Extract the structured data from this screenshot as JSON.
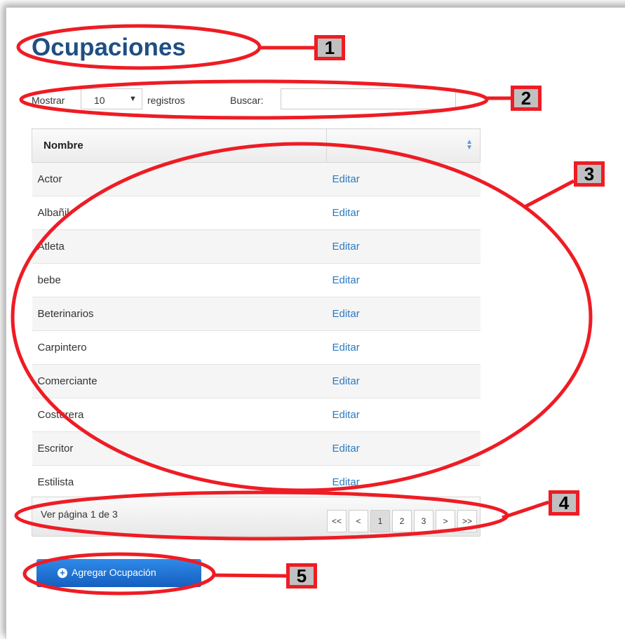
{
  "page": {
    "title": "Ocupaciones"
  },
  "controls": {
    "show_label": "Mostrar",
    "page_size": "10",
    "records_label": "registros",
    "search_label": "Buscar:",
    "search_value": ""
  },
  "table": {
    "columns": [
      "Nombre",
      ""
    ],
    "rows": [
      {
        "name": "Actor",
        "action": "Editar"
      },
      {
        "name": "Albañil",
        "action": "Editar"
      },
      {
        "name": "Atleta",
        "action": "Editar"
      },
      {
        "name": "bebe",
        "action": "Editar"
      },
      {
        "name": "Beterinarios",
        "action": "Editar"
      },
      {
        "name": "Carpintero",
        "action": "Editar"
      },
      {
        "name": "Comerciante",
        "action": "Editar"
      },
      {
        "name": "Costurera",
        "action": "Editar"
      },
      {
        "name": "Escritor",
        "action": "Editar"
      },
      {
        "name": "Estilista",
        "action": "Editar"
      }
    ]
  },
  "pagination": {
    "info": "Ver página 1 de 3",
    "buttons": [
      "<<",
      "<",
      "1",
      "2",
      "3",
      ">",
      ">>"
    ],
    "current": "1"
  },
  "add_button": {
    "label": "Agregar Ocupación",
    "icon": "plus-circle-icon"
  },
  "annotations": [
    "1",
    "2",
    "3",
    "4",
    "5"
  ],
  "colors": {
    "annotation": "#ee1c24",
    "title": "#1f4f82",
    "link": "#2a7bc0",
    "button": "#1b6fd0"
  }
}
